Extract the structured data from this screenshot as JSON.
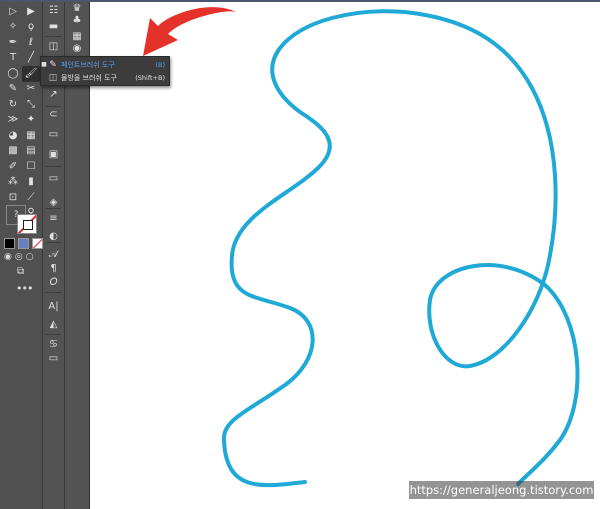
{
  "colors": {
    "canvas": "#ffffff",
    "toolbar_bg": "#505050",
    "stroke_path": "#1fa9d6",
    "annotation_arrow": "#e4322b",
    "flyout_bg": "#3c3c3c",
    "selected_text": "#5aa0e8"
  },
  "toolbar": {
    "tools": [
      {
        "icon": "selection-icon",
        "glyph": "▷"
      },
      {
        "icon": "direct-selection-icon",
        "glyph": "▶"
      },
      {
        "icon": "magic-wand-icon",
        "glyph": "✧"
      },
      {
        "icon": "lasso-icon",
        "glyph": "ϙ"
      },
      {
        "icon": "pen-icon",
        "glyph": "✒"
      },
      {
        "icon": "curvature-icon",
        "glyph": "ℓ"
      },
      {
        "icon": "type-icon",
        "glyph": "T"
      },
      {
        "icon": "line-segment-icon",
        "glyph": "╱"
      },
      {
        "icon": "ellipse-icon",
        "glyph": "◯"
      },
      {
        "icon": "paintbrush-icon",
        "glyph": "🖌",
        "active": true
      },
      {
        "icon": "shaper-icon",
        "glyph": "✎"
      },
      {
        "icon": "eraser-icon",
        "glyph": "✂"
      },
      {
        "icon": "rotate-icon",
        "glyph": "↻"
      },
      {
        "icon": "scale-icon",
        "glyph": "⤡"
      },
      {
        "icon": "width-icon",
        "glyph": "≫"
      },
      {
        "icon": "puppet-warp-icon",
        "glyph": "✦"
      },
      {
        "icon": "shape-builder-icon",
        "glyph": "◕"
      },
      {
        "icon": "perspective-grid-icon",
        "glyph": "▦"
      },
      {
        "icon": "mesh-icon",
        "glyph": "▩"
      },
      {
        "icon": "gradient-icon",
        "glyph": "▤"
      },
      {
        "icon": "eyedropper-icon",
        "glyph": "✐"
      },
      {
        "icon": "measure-icon",
        "glyph": "☐"
      },
      {
        "icon": "symbol-sprayer-icon",
        "glyph": "⁂"
      },
      {
        "icon": "column-graph-icon",
        "glyph": "▮"
      },
      {
        "icon": "artboard-icon",
        "glyph": "⊡"
      },
      {
        "icon": "slice-icon",
        "glyph": "⟋"
      },
      {
        "icon": "hand-icon",
        "glyph": "✋"
      },
      {
        "icon": "zoom-icon",
        "glyph": "⚲"
      }
    ],
    "fill_glyph": "?",
    "mode_glyphs": [
      "■",
      "▣",
      "⧄"
    ],
    "draw_mode_glyphs": [
      "◉",
      "◎",
      "○"
    ],
    "screen_mode_glyph": "⧉",
    "more_tools_glyph": "•••"
  },
  "panels": {
    "column1": [
      "☷",
      "▬",
      "◫",
      "▣",
      "⊞",
      "↗",
      "⊂",
      "▭",
      "▣",
      "▭",
      "◈",
      "≡",
      "◐",
      "𝒜",
      "¶",
      "𝑂",
      "A|",
      "◭",
      "♋",
      "▭"
    ],
    "column2": [
      "♛",
      "♣",
      "▦",
      "◉"
    ]
  },
  "flyout": {
    "items": [
      {
        "icon": "paintbrush-tool-icon",
        "glyph": "✎",
        "label": "페인트브러쉬 도구",
        "shortcut": "(B)",
        "selected": true
      },
      {
        "icon": "blob-brush-tool-icon",
        "glyph": "◫",
        "label": "물방울 브러쉬 도구",
        "shortcut": "(Shift+B)",
        "selected": false
      }
    ]
  },
  "watermark": "https://generaljeong.tistory.com"
}
